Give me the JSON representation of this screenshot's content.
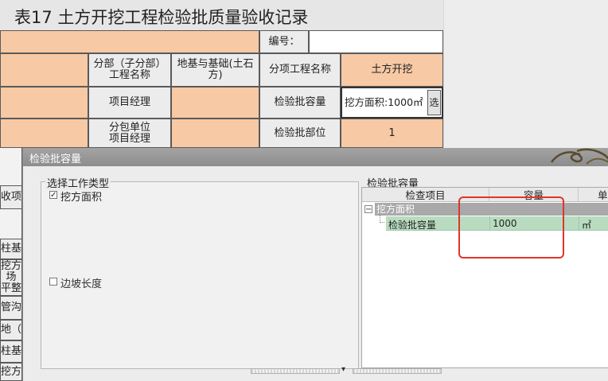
{
  "form": {
    "title": "表17  土方开挖工程检验批质量验收记录",
    "number_label": "编号：",
    "header_row": {
      "col2": "分部（子分部）\n工程名称",
      "col3": "地基与基础(土石\n方)",
      "col4": "分项工程名称",
      "col5": "土方开挖"
    },
    "row2": {
      "col2": "项目经理",
      "col4": "检验批容量",
      "col5": "挖方面积:1000㎡",
      "select_button": "选"
    },
    "row3": {
      "col2": "分包单位\n项目经理",
      "col4": "检验批部位",
      "col5": "1"
    }
  },
  "left_clip": {
    "items": [
      "收项目",
      "柱基",
      "挖方场\n平整",
      "管沟",
      "地（路",
      "柱基",
      "挖方"
    ]
  },
  "dialog": {
    "title": "检验批容量",
    "work_types": {
      "legend": "选择工作类型",
      "items": [
        {
          "label": "挖方面积",
          "checked": true
        },
        {
          "label": "边坡长度",
          "checked": false
        }
      ]
    },
    "capacity": {
      "legend": "检验批容量",
      "columns": [
        "检查项目",
        "容量",
        "单"
      ],
      "group_row": {
        "expander": "−",
        "label": "挖方面积"
      },
      "rows": [
        {
          "item": "检验批容量",
          "capacity": "1000",
          "unit": "㎡"
        }
      ]
    }
  },
  "colors": {
    "peach": "#f7c9a4",
    "highlight": "#e0352b",
    "row_selected": "#b9dcc0"
  }
}
